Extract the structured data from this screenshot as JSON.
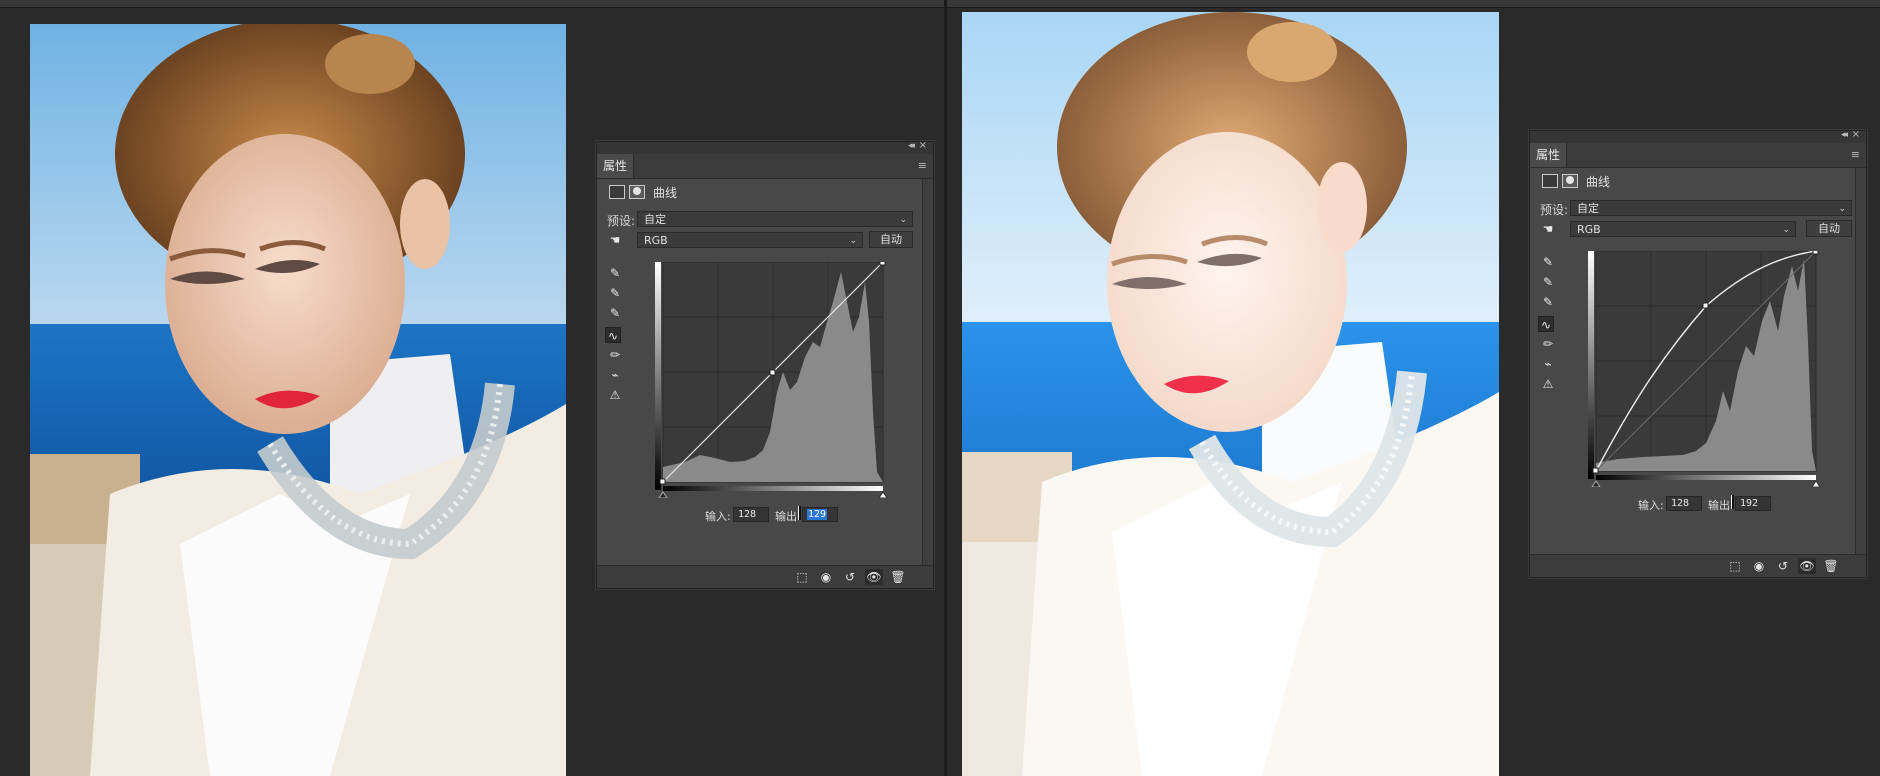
{
  "panel_tab": "属性",
  "adjustment_title": "曲线",
  "preset_label": "预设:",
  "preset_value": "自定",
  "channel_value": "RGB",
  "auto_button": "自动",
  "input_label": "输入:",
  "output_label": "输出:",
  "left": {
    "input_value": "128",
    "output_value": "129"
  },
  "right": {
    "input_value": "128",
    "output_value": "192"
  },
  "icons": {
    "collapse": "collapse-icon",
    "close": "close-icon",
    "menu": "panel-menu-icon",
    "curves": "curves-adjustment-icon",
    "mask": "layer-mask-icon",
    "targeted_adjust": "targeted-adjust-icon",
    "black_point": "eyedropper-black-icon",
    "gray_point": "eyedropper-gray-icon",
    "white_point": "eyedropper-white-icon",
    "edit_points": "curve-point-edit-icon",
    "draw_pencil": "pencil-draw-icon",
    "smooth": "smooth-curve-icon",
    "clipping": "clipping-warning-icon",
    "clip_to_layer": "clip-to-layer-icon",
    "view_previous": "view-previous-state-icon",
    "reset": "reset-icon",
    "visibility": "visibility-eye-icon",
    "delete": "trash-icon"
  },
  "glyphs": {
    "collapse": "◂◂",
    "close": "×",
    "menu": "≡",
    "targeted_adjust": "☚",
    "black_point": "✎",
    "gray_point": "✎",
    "white_point": "✎",
    "edit_points": "∿",
    "draw_pencil": "✏",
    "smooth": "⌁",
    "clipping": "⚠",
    "clip_to_layer": "⬚",
    "view_previous": "◉",
    "reset": "↺",
    "visibility": "👁",
    "delete": "🗑",
    "chevron": "⌄"
  },
  "colors": {
    "workspace": "#2b2b2b",
    "panel": "#484848",
    "selection": "#2a76d6"
  }
}
